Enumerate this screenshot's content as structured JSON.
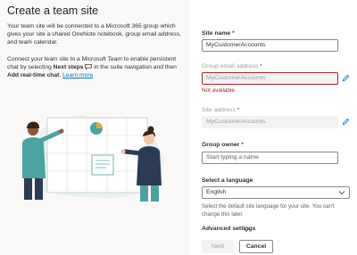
{
  "page": {
    "title": "Create a team site",
    "intro": "Your team site will be connected to a Microsoft 365 group which gives your site a shared OneNote notebook, group email address, and team calendar.",
    "connect_part1": "Connect your team site to a Microsoft Team to enable persistent chat by selecting ",
    "connect_bold1": "Next steps",
    "connect_part2": " in the suite navigation and then ",
    "connect_bold2": "Add real-time chat",
    "connect_part3": ". ",
    "learn_more": "Learn more"
  },
  "form": {
    "site_name": {
      "label": "Site name",
      "required": "*",
      "value": "MyCustomerAccounts"
    },
    "group_email": {
      "label": "Group email address",
      "required": "*",
      "value": "MyCustomerAccounts",
      "error": "Not available"
    },
    "site_address": {
      "label": "Site address",
      "required": "*",
      "value": "MyCustomerAccounts"
    },
    "group_owner": {
      "label": "Group owner",
      "required": "*",
      "placeholder": "Start typing a name"
    },
    "language": {
      "label": "Select a language",
      "value": "English",
      "help": "Select the default site language for your site. You can't change this later."
    },
    "advanced_label": "Advanced settings"
  },
  "buttons": {
    "next": "Next",
    "cancel": "Cancel"
  },
  "colors": {
    "accent": "#0078d4",
    "error": "#a4262c",
    "left_bg": "#faf9f8",
    "teal": "#4aa3a0",
    "skin_dark": "#8b5a3c",
    "skin_light": "#f2c7a5"
  },
  "icons": [
    "pencil-icon",
    "chevron-down-icon",
    "chat-icon"
  ]
}
